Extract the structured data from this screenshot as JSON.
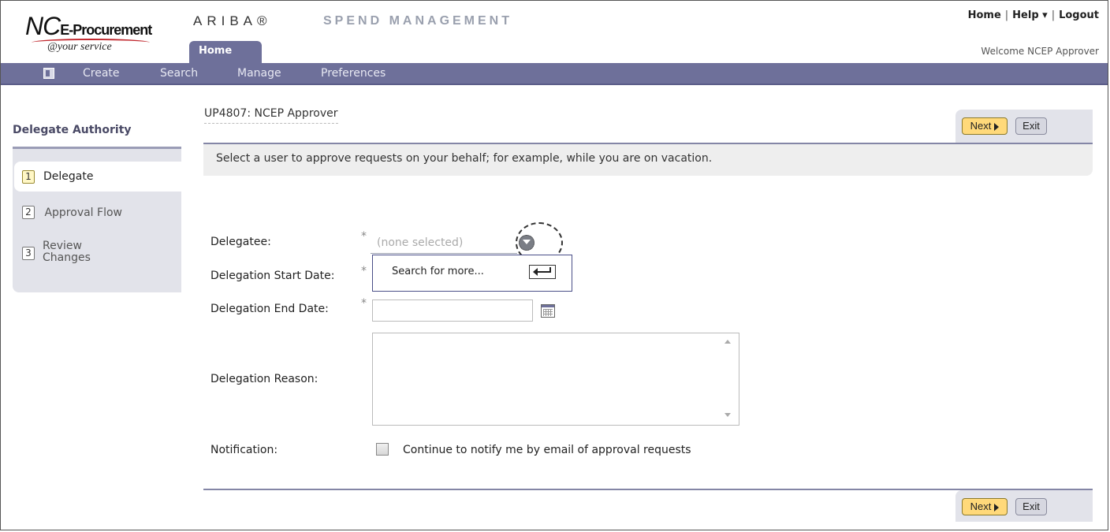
{
  "header": {
    "logo_nc": "NC",
    "logo_ep": "E-Procurement",
    "logo_sub": "@your service",
    "ariba": "ARIBA®",
    "spend": "SPEND MANAGEMENT",
    "links": {
      "home": "Home",
      "help": "Help ▾",
      "logout": "Logout"
    },
    "welcome": "Welcome NCEP Approver",
    "active_tab": "Home"
  },
  "nav": {
    "items": [
      "Create",
      "Search",
      "Manage",
      "Preferences"
    ]
  },
  "sidebar": {
    "title": "Delegate Authority",
    "steps": [
      {
        "num": "1",
        "label": "Delegate"
      },
      {
        "num": "2",
        "label": "Approval Flow"
      },
      {
        "num": "3",
        "label": "Review Changes"
      }
    ]
  },
  "main": {
    "user_title": "UP4807: NCEP Approver",
    "next_label": "Next",
    "exit_label": "Exit",
    "info": "Select a user to approve requests on your behalf; for example, while you are on vacation.",
    "fields": {
      "delegatee": "Delegatee:",
      "start_date": "Delegation Start Date:",
      "end_date": "Delegation End Date:",
      "reason": "Delegation Reason:",
      "notification": "Notification:"
    },
    "required_mark": "*",
    "delegatee_placeholder": "(none selected)",
    "dropdown_option": "Search for more...",
    "notify_label": "Continue to notify me by email of approval requests"
  },
  "colors": {
    "nav_bg": "#6e709a",
    "next_button": "#ffd97a",
    "panel": "#e2e3ea"
  }
}
